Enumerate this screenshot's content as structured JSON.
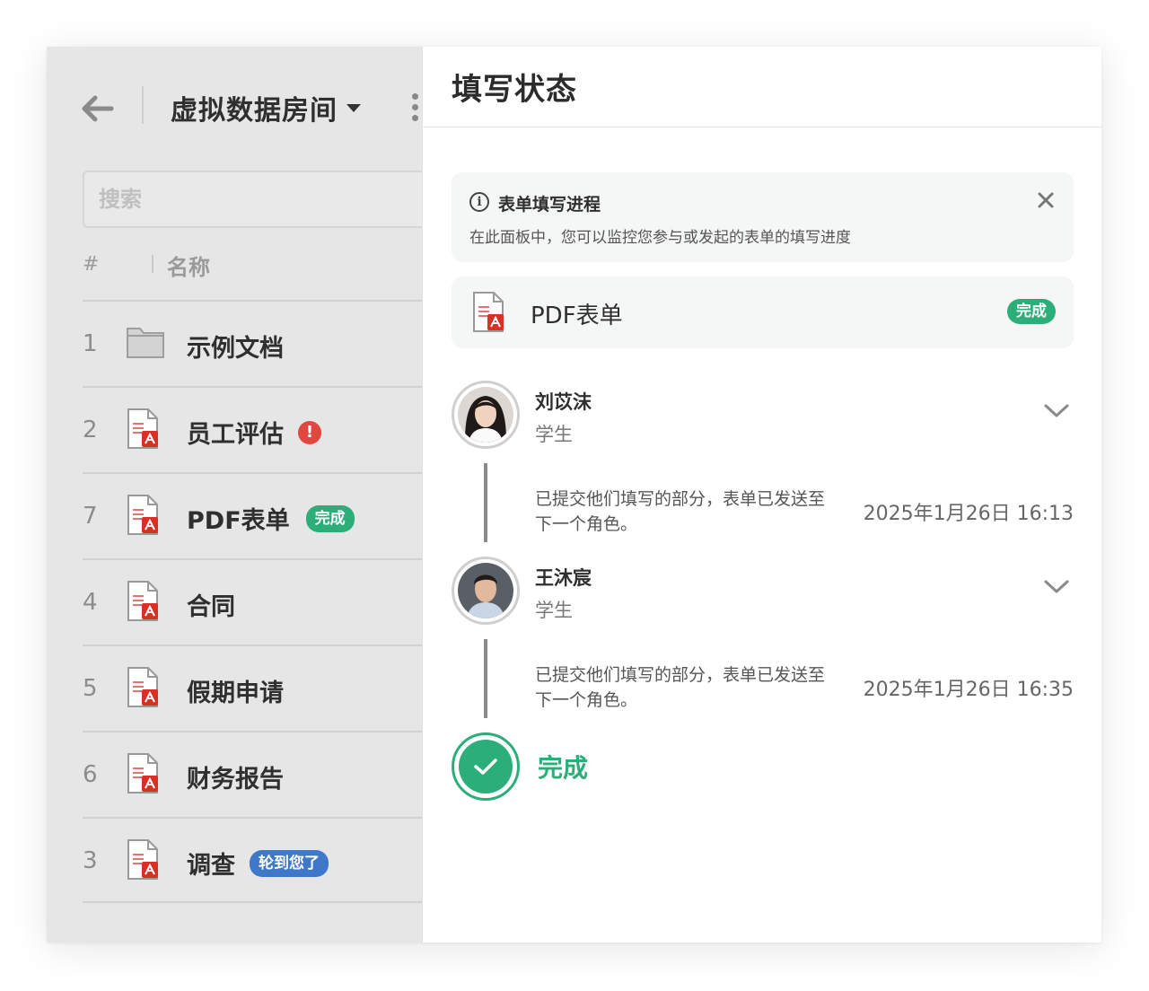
{
  "header": {
    "room_title": "虚拟数据房间"
  },
  "search": {
    "placeholder": "搜索"
  },
  "table": {
    "col_number": "#",
    "col_name": "名称",
    "rows": [
      {
        "number": "1",
        "name": "示例文档",
        "type": "folder-icon"
      },
      {
        "number": "2",
        "name": "员工评估",
        "type": "pdf-icon",
        "alert": "!"
      },
      {
        "number": "7",
        "name": "PDF表单",
        "type": "pdf-icon",
        "badge": "完成"
      },
      {
        "number": "4",
        "name": "合同",
        "type": "pdf-icon"
      },
      {
        "number": "5",
        "name": "假期申请",
        "type": "pdf-icon"
      },
      {
        "number": "6",
        "name": "财务报告",
        "type": "pdf-icon"
      },
      {
        "number": "3",
        "name": "调查",
        "type": "pdf-icon",
        "badge": "轮到您了"
      }
    ]
  },
  "panel": {
    "title": "填写状态",
    "info": {
      "title": "表单填写进程",
      "description": "在此面板中，您可以监控您参与或发起的表单的填写进度"
    },
    "form": {
      "name": "PDF表单",
      "status": "完成"
    },
    "steps": [
      {
        "name": "刘苡沫",
        "role": "学生",
        "note": "已提交他们填写的部分，表单已发送至下一个角色。",
        "time": "2025年1月26日 16:13"
      },
      {
        "name": "王沐宸",
        "role": "学生",
        "note": "已提交他们填写的部分，表单已发送至下一个角色。",
        "time": "2025年1月26日 16:35"
      }
    ],
    "done_label": "完成"
  },
  "colors": {
    "accent_green": "#2bae78",
    "accent_blue": "#3f78c8",
    "alert_red": "#e0473e"
  }
}
